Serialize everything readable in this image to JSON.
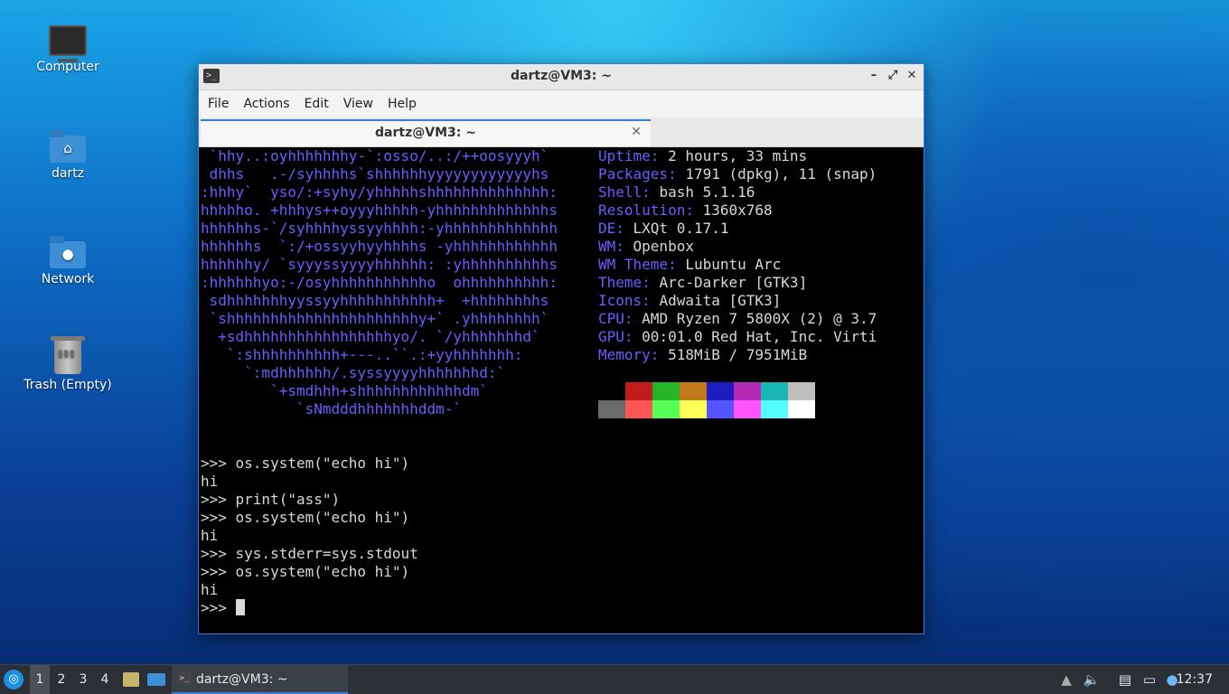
{
  "desktop": {
    "icons": [
      {
        "label": "Computer",
        "icon": "computer-icon"
      },
      {
        "label": "dartz",
        "icon": "home-folder-icon"
      },
      {
        "label": "Network",
        "icon": "network-folder-icon"
      },
      {
        "label": "Trash (Empty)",
        "icon": "trash-icon"
      }
    ]
  },
  "window": {
    "title": "dartz@VM3: ~",
    "menu": [
      "File",
      "Actions",
      "Edit",
      "View",
      "Help"
    ],
    "tab_label": "dartz@VM3: ~",
    "controls": {
      "minimize": "–",
      "maximize": "⤢",
      "close": "✕",
      "tab_close": "✕"
    }
  },
  "terminal": {
    "logo": " `hhy..:oyhhhhhhhy-`:osso/..:/++oosyyyh`\n dhhs   .-/syhhhhs`shhhhhhyyyyyyyyyyyyhs\n:hhhy`  yso/:+syhy/yhhhhhshhhhhhhhhhhhhh:\nhhhhho. +hhhys++oyyyhhhhh-yhhhhhhhhhhhhhs\nhhhhhhs-`/syhhhhyssyyhhhh:-yhhhhhhhhhhhhh\nhhhhhhs  `:/+ossyyhyyhhhhs -yhhhhhhhhhhhh\nhhhhhhy/ `syyyssyyyyhhhhhh: :yhhhhhhhhhhs\n:hhhhhhyo:-/osyhhhhhhhhhhho  ohhhhhhhhhh:\n sdhhhhhhhyyssyyhhhhhhhhhhh+  +hhhhhhhhs\n `shhhhhhhhhhhhhhhhhhhhhhy+` .yhhhhhhhh`\n  +sdhhhhhhhhhhhhhhhhhyo/. `/yhhhhhhhd`\n   `:shhhhhhhhhh+---..``.:+yyhhhhhhh:\n     `:mdhhhhhh/.syssyyyyhhhhhhhd:`\n        `+smdhhh+shhhhhhhhhhhhdm`\n           `sNmdddhhhhhhhddm-`",
    "info": [
      {
        "key": "Uptime",
        "value": "2 hours, 33 mins"
      },
      {
        "key": "Packages",
        "value": "1791 (dpkg), 11 (snap)"
      },
      {
        "key": "Shell",
        "value": "bash 5.1.16"
      },
      {
        "key": "Resolution",
        "value": "1360x768"
      },
      {
        "key": "DE",
        "value": "LXQt 0.17.1"
      },
      {
        "key": "WM",
        "value": "Openbox"
      },
      {
        "key": "WM Theme",
        "value": "Lubuntu Arc"
      },
      {
        "key": "Theme",
        "value": "Arc-Darker [GTK3]"
      },
      {
        "key": "Icons",
        "value": "Adwaita [GTK3]"
      },
      {
        "key": "CPU",
        "value": "AMD Ryzen 7 5800X (2) @ 3.7"
      },
      {
        "key": "GPU",
        "value": "00:01.0 Red Hat, Inc. Virti"
      },
      {
        "key": "Memory",
        "value": "518MiB / 7951MiB"
      }
    ],
    "palette_row1": [
      "#000000",
      "#c01c1c",
      "#26b526",
      "#c07a1c",
      "#1c1cc0",
      "#b52ab5",
      "#1cb5b5",
      "#bfbfbf"
    ],
    "palette_row2": [
      "#6b6b6b",
      "#ff5555",
      "#55ff55",
      "#ffff55",
      "#5555ff",
      "#ff55ff",
      "#55ffff",
      "#ffffff"
    ],
    "repl_lines": [
      ">>> os.system(\"echo hi\")",
      "hi",
      ">>> print(\"ass\")",
      ">>> os.system(\"echo hi\")",
      "hi",
      ">>> sys.stderr=sys.stdout",
      ">>> os.system(\"echo hi\")",
      "hi"
    ],
    "prompt": ">>> "
  },
  "taskbar": {
    "desktops": [
      "1",
      "2",
      "3",
      "4"
    ],
    "active_desktop": "1",
    "task_label": "dartz@VM3: ~",
    "clock": "12:37",
    "tray_icons": [
      "up-arrow-icon",
      "volume-icon",
      "clipboard-icon",
      "network-icon",
      "notification-icon"
    ]
  },
  "colors": {
    "accent": "#3a7bd5",
    "logo": "#6b5cff"
  }
}
